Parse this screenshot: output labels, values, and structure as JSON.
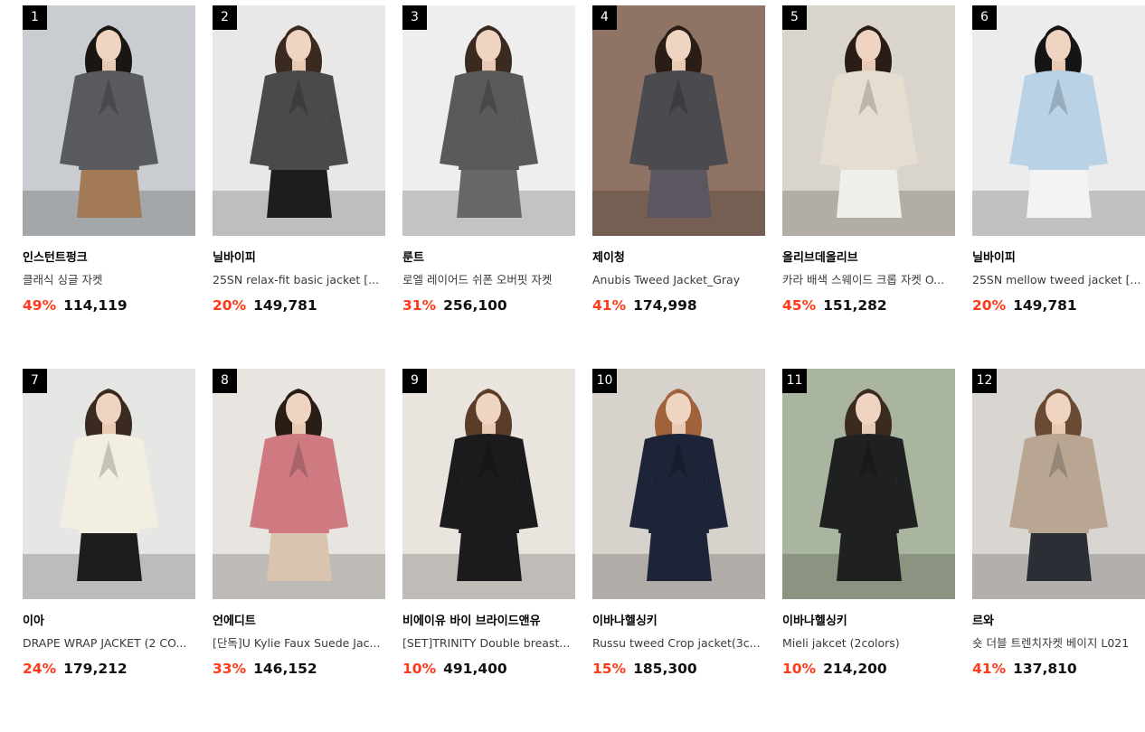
{
  "colors": {
    "discount": "#ff3a1a",
    "rank_badge": "#000000"
  },
  "products": [
    {
      "rank": "1",
      "brand": "인스턴트펑크",
      "name": "클래식 싱글 자켓",
      "discount": "49%",
      "price": "114,119",
      "bg": "#c9ccd0",
      "garment": "#585a5d",
      "bottom": "#a27a58",
      "hair": "#1a1614",
      "icon": "jacket-photo"
    },
    {
      "rank": "2",
      "brand": "닐바이피",
      "name": "25SN relax-fit basic jacket [...",
      "discount": "20%",
      "price": "149,781",
      "bg": "#e9e8e6",
      "garment": "#4a4a48",
      "bottom": "#1d1d1d",
      "hair": "#3a2a20",
      "icon": "jacket-photo"
    },
    {
      "rank": "3",
      "brand": "룬트",
      "name": "로엘 레이어드 쉬폰 오버핏 자켓",
      "discount": "31%",
      "price": "256,100",
      "bg": "#eeeeee",
      "garment": "#5c5a58",
      "bottom": "#6a6866",
      "hair": "#3a2a20",
      "icon": "jacket-photo"
    },
    {
      "rank": "4",
      "brand": "제이청",
      "name": "Anubis Tweed Jacket_Gray",
      "discount": "41%",
      "price": "174,998",
      "bg": "#8f7466",
      "garment": "#4b4b4f",
      "bottom": "#5b5660",
      "hair": "#2a1d16",
      "icon": "jacket-photo"
    },
    {
      "rank": "5",
      "brand": "올리브데올리브",
      "name": "카라 배색 스웨이드 크롭 자켓 O...",
      "discount": "45%",
      "price": "151,282",
      "bg": "#d9d4cc",
      "garment": "#e4ddd0",
      "bottom": "#f1efea",
      "hair": "#2a1d16",
      "icon": "jacket-photo"
    },
    {
      "rank": "6",
      "brand": "닐바이피",
      "name": "25SN mellow tweed jacket [...",
      "discount": "20%",
      "price": "149,781",
      "bg": "#ececec",
      "garment": "#b9d2e6",
      "bottom": "#f3f3f3",
      "hair": "#151515",
      "icon": "jacket-photo"
    },
    {
      "rank": "7",
      "brand": "이아",
      "name": "DRAPE WRAP JACKET (2 CO...",
      "discount": "24%",
      "price": "179,212",
      "bg": "#e6e6e4",
      "garment": "#f2efe2",
      "bottom": "#1d1d1d",
      "hair": "#3a2a20",
      "icon": "jacket-photo"
    },
    {
      "rank": "8",
      "brand": "언에디트",
      "name": "[단독]U Kylie Faux Suede Jac...",
      "discount": "33%",
      "price": "146,152",
      "bg": "#e8e4df",
      "garment": "#cf7a80",
      "bottom": "#d9c4b0",
      "hair": "#2a1d16",
      "icon": "jacket-photo"
    },
    {
      "rank": "9",
      "brand": "비에이유 바이 브라이드앤유",
      "name": "[SET]TRINITY Double breast...",
      "discount": "10%",
      "price": "491,400",
      "bg": "#e9e4de",
      "garment": "#1b1b1d",
      "bottom": "#1b1b1d",
      "hair": "#5a3d28",
      "icon": "jacket-photo"
    },
    {
      "rank": "10",
      "brand": "이바나헬싱키",
      "name": "Russu tweed Crop jacket(3c...",
      "discount": "15%",
      "price": "185,300",
      "bg": "#d8d2cc",
      "garment": "#1e2438",
      "bottom": "#1e2438",
      "hair": "#a0623a",
      "icon": "jacket-photo"
    },
    {
      "rank": "11",
      "brand": "이바나헬싱키",
      "name": "Mieli jakcet (2colors)",
      "discount": "10%",
      "price": "214,200",
      "bg": "#a9b59e",
      "garment": "#1f2120",
      "bottom": "#1f2120",
      "hair": "#3a2a20",
      "icon": "jacket-photo"
    },
    {
      "rank": "12",
      "brand": "르와",
      "name": "숏 더블 트렌치자켓 베이지 L021",
      "discount": "41%",
      "price": "137,810",
      "bg": "#d9d6d2",
      "garment": "#b8a693",
      "bottom": "#2b2e35",
      "hair": "#6a4a33",
      "icon": "jacket-photo"
    }
  ]
}
